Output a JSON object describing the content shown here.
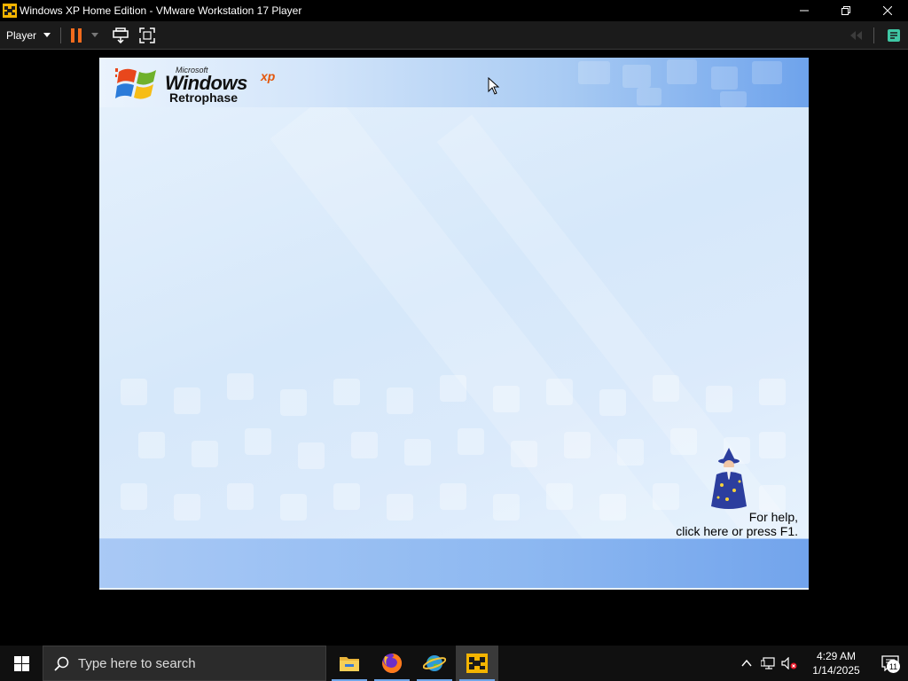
{
  "window": {
    "title": "Windows XP Home Edition - VMware Workstation 17 Player",
    "app_icon": "vmware-icon",
    "controls": [
      "minimize-icon",
      "restore-icon",
      "close-icon"
    ]
  },
  "toolbar": {
    "player_menu_label": "Player",
    "buttons": [
      "pause-icon",
      "send-ctrl-alt-del-icon",
      "full-screen-icon"
    ],
    "right_buttons": [
      "back-icon",
      "unity-icon"
    ],
    "colors": {
      "pause": "#f26b1d",
      "unity": "#3fc7a4"
    }
  },
  "guest": {
    "logo": {
      "microsoft": "Microsoft",
      "windows": "Windows",
      "xp": "xp",
      "edition": "Retrophase"
    },
    "help": {
      "line1": "For help,",
      "line2": "click here or press F1."
    },
    "colors": {
      "xp_orange": "#e3570d",
      "top_band": "#6ea3ec",
      "bottom_band": "#8db8f1"
    }
  },
  "taskbar": {
    "search_placeholder": "Type here to search",
    "apps": [
      {
        "name": "file-explorer-icon",
        "active": false
      },
      {
        "name": "firefox-icon",
        "active": false
      },
      {
        "name": "ie-globe-icon",
        "active": false
      },
      {
        "name": "vmware-icon",
        "active": true
      }
    ],
    "tray": [
      "chevron-up-icon",
      "network-icon",
      "volume-muted-icon"
    ],
    "time": "4:29 AM",
    "date": "1/14/2025",
    "notification_count": "11"
  }
}
